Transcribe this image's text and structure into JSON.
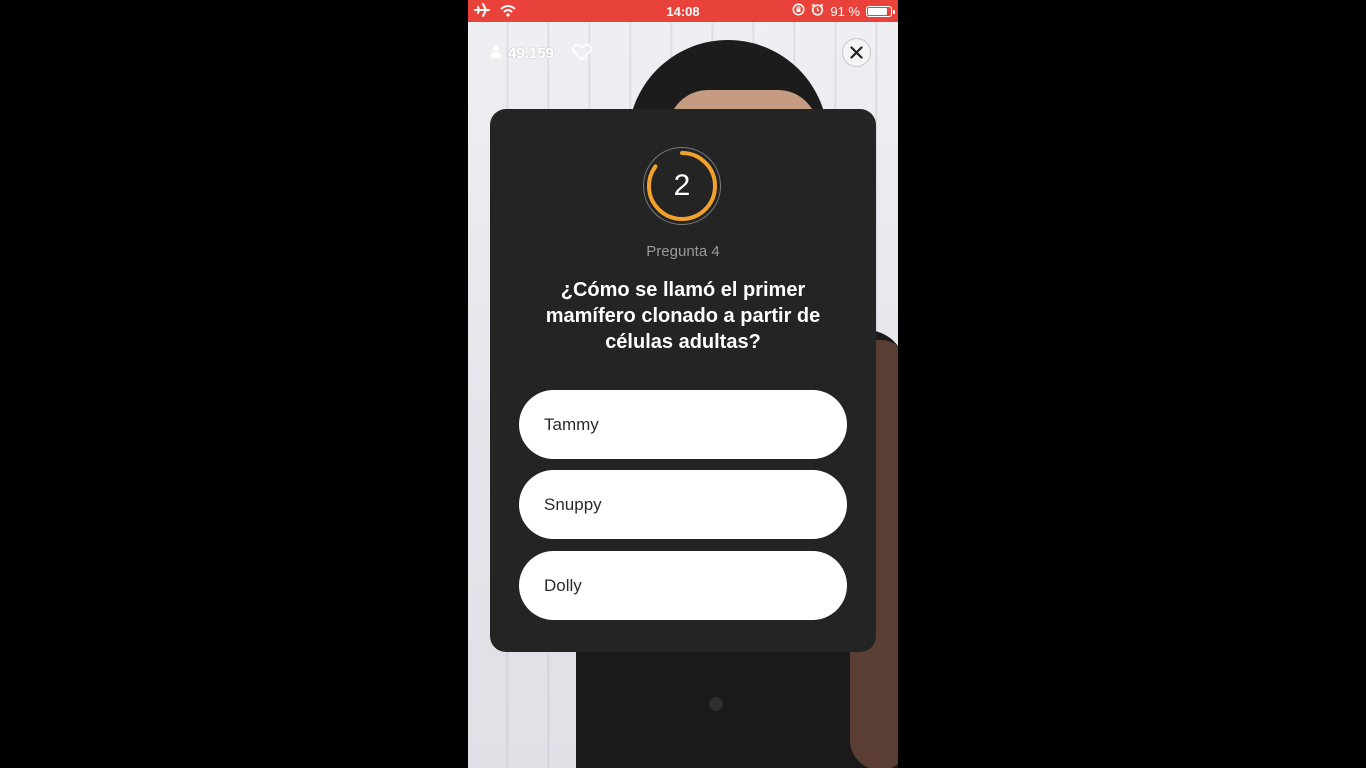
{
  "status_bar": {
    "time": "14:08",
    "battery_text": "91 %",
    "battery_level": 0.91,
    "icons": [
      "airplane-icon",
      "wifi-icon",
      "rotation-lock-icon",
      "alarm-icon",
      "battery-icon"
    ],
    "background_color": "#e8423b"
  },
  "overlay": {
    "viewer_count": "49.159"
  },
  "quiz": {
    "timer_value": "2",
    "timer_progress": 0.85,
    "timer_color": "#f2a22a",
    "question_number": "Pregunta 4",
    "question": "¿Cómo se llamó el primer mamífero clonado a partir de células adultas?",
    "answers": [
      "Tammy",
      "Snuppy",
      "Dolly"
    ]
  }
}
